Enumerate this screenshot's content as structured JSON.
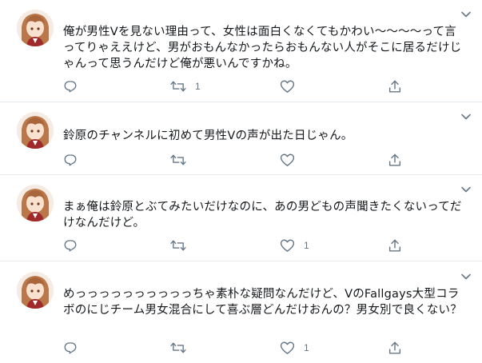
{
  "tweets": [
    {
      "text": "俺が男性Vを見ない理由って、女性は面白くなくてもかわい〜〜〜〜って言ってりゃええけど、男がおもんなかったらおもんない人がそこに居るだけじゃんって思うんだけど俺が悪いんですかね。",
      "reply_count": "",
      "retweet_count": "1",
      "like_count": "",
      "share_count": ""
    },
    {
      "text": "鈴原のチャンネルに初めて男性Vの声が出た日じゃん。",
      "reply_count": "",
      "retweet_count": "",
      "like_count": "",
      "share_count": ""
    },
    {
      "text": "まぁ俺は鈴原とぶてみたいだけなのに、あの男どもの声聞きたくないってだけなんだけど。",
      "reply_count": "",
      "retweet_count": "",
      "like_count": "1",
      "share_count": ""
    },
    {
      "text": "めっっっっっっっっっっちゃ素朴な疑問なんだけど、VのFallgays大型コラボのにじチーム男女混合にして喜ぶ層どんだけおんの？男女別で良くない？",
      "reply_count": "",
      "retweet_count": "",
      "like_count": "1",
      "share_count": ""
    }
  ],
  "icons": {
    "reply": "reply-icon",
    "retweet": "retweet-icon",
    "like": "like-icon",
    "share": "share-icon",
    "caret": "chevron-down-icon"
  },
  "colors": {
    "icon": "#657786",
    "divider": "#e6ecf0",
    "text": "#14171a"
  }
}
